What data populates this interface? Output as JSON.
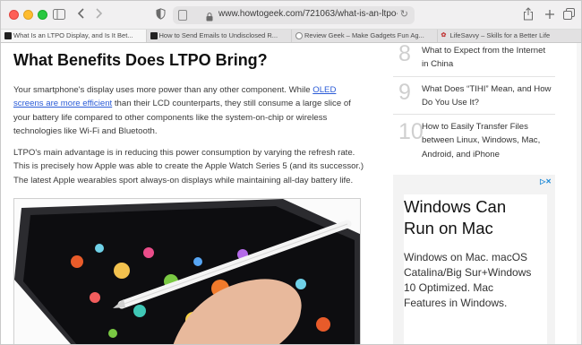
{
  "browser": {
    "url": "www.howtogeek.com/721063/what-is-an-ltpo-display",
    "tabs": [
      {
        "label": "What Is an LTPO Display, and Is It Bet...",
        "favicon": "htg-icon",
        "active": true
      },
      {
        "label": "How to Send Emails to Undisclosed R...",
        "favicon": "htg-icon",
        "active": false
      },
      {
        "label": "Review Geek – Make Gadgets Fun Ag...",
        "favicon": "reviewgeek-icon",
        "active": false
      },
      {
        "label": "LifeSavvy – Skills for a Better Life",
        "favicon": "lifesavvy-icon",
        "active": false
      }
    ]
  },
  "article": {
    "heading": "What Benefits Does LTPO Bring?",
    "p1_before": "Your smartphone's display uses more power than any other component. While ",
    "p1_link": "OLED screens are more efficient",
    "p1_after": " than their LCD counterparts, they still consume a large slice of your battery life compared to other components like the system-on-chip or wireless technologies like Wi-Fi and Bluetooth.",
    "p2": "LTPO's main advantage is in reducing this power consumption by varying the refresh rate. This is precisely how Apple was able to create the Apple Watch Series 5 (and its successor.) The latest Apple wearables sport always-on displays while maintaining all-day battery life."
  },
  "sidebar": {
    "items": [
      {
        "num": "8",
        "text": "What to Expect from the Internet in China"
      },
      {
        "num": "9",
        "text": "What Does “TIHI” Mean, and How Do You Use It?"
      },
      {
        "num": "10",
        "text": "How to Easily Transfer Files between Linux, Windows, Mac, Android, and iPhone"
      }
    ]
  },
  "ad": {
    "title": "Windows Can Run on Mac",
    "body": "Windows on Mac. macOS Catalina/Big Sur+Windows 10 Optimized. Mac Features in Windows."
  },
  "colors": {
    "link": "#2a5bd7",
    "adchoices": "#1e8ad8"
  }
}
